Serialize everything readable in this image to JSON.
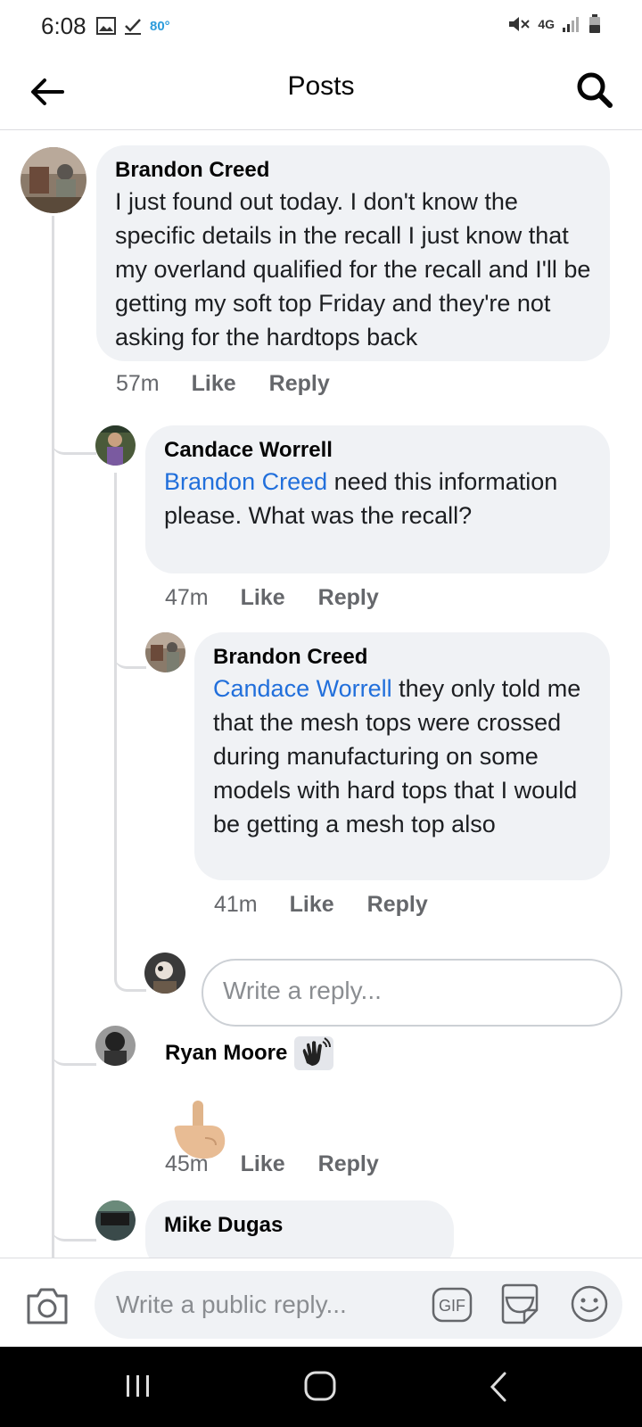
{
  "status_bar": {
    "time": "6:08",
    "temperature": "80°",
    "network": "4G"
  },
  "header": {
    "title": "Posts"
  },
  "comments": [
    {
      "author": "Brandon Creed",
      "text": "I just found out today. I don't know the specific details in the recall I just know that my overland qualified for the recall and I'll be getting my soft top Friday and they're not asking for the hardtops back",
      "time": "57m",
      "like": "Like",
      "reply": "Reply"
    },
    {
      "author": "Candace Worrell",
      "mention": "Brandon Creed",
      "text": " need this information please.  What was the recall?",
      "time": "47m",
      "like": "Like",
      "reply": "Reply"
    },
    {
      "author": "Brandon Creed",
      "mention": "Candace Worrell",
      "text": "  they only told me that the mesh tops were crossed during manufacturing on some models with hard tops that I would be getting a mesh top  also",
      "time": "41m",
      "like": "Like",
      "reply": "Reply"
    },
    {
      "author": "Ryan Moore",
      "badge_icon": "waving-hand-badge-icon",
      "emoji_icon": "pointing-down-hand-icon",
      "time": "45m",
      "like": "Like",
      "reply": "Reply"
    },
    {
      "author": "Mike Dugas"
    }
  ],
  "reply_field": {
    "placeholder": "Write a reply..."
  },
  "composer": {
    "placeholder": "Write a public reply...",
    "gif_label": "GIF"
  },
  "icons": {
    "back": "back-arrow-icon",
    "search": "search-icon",
    "camera": "camera-icon",
    "sticker": "sticker-icon",
    "emoji": "emoji-icon"
  },
  "colors": {
    "mention": "#216fdb",
    "bubble": "#f0f2f5",
    "meta": "#65676b"
  }
}
